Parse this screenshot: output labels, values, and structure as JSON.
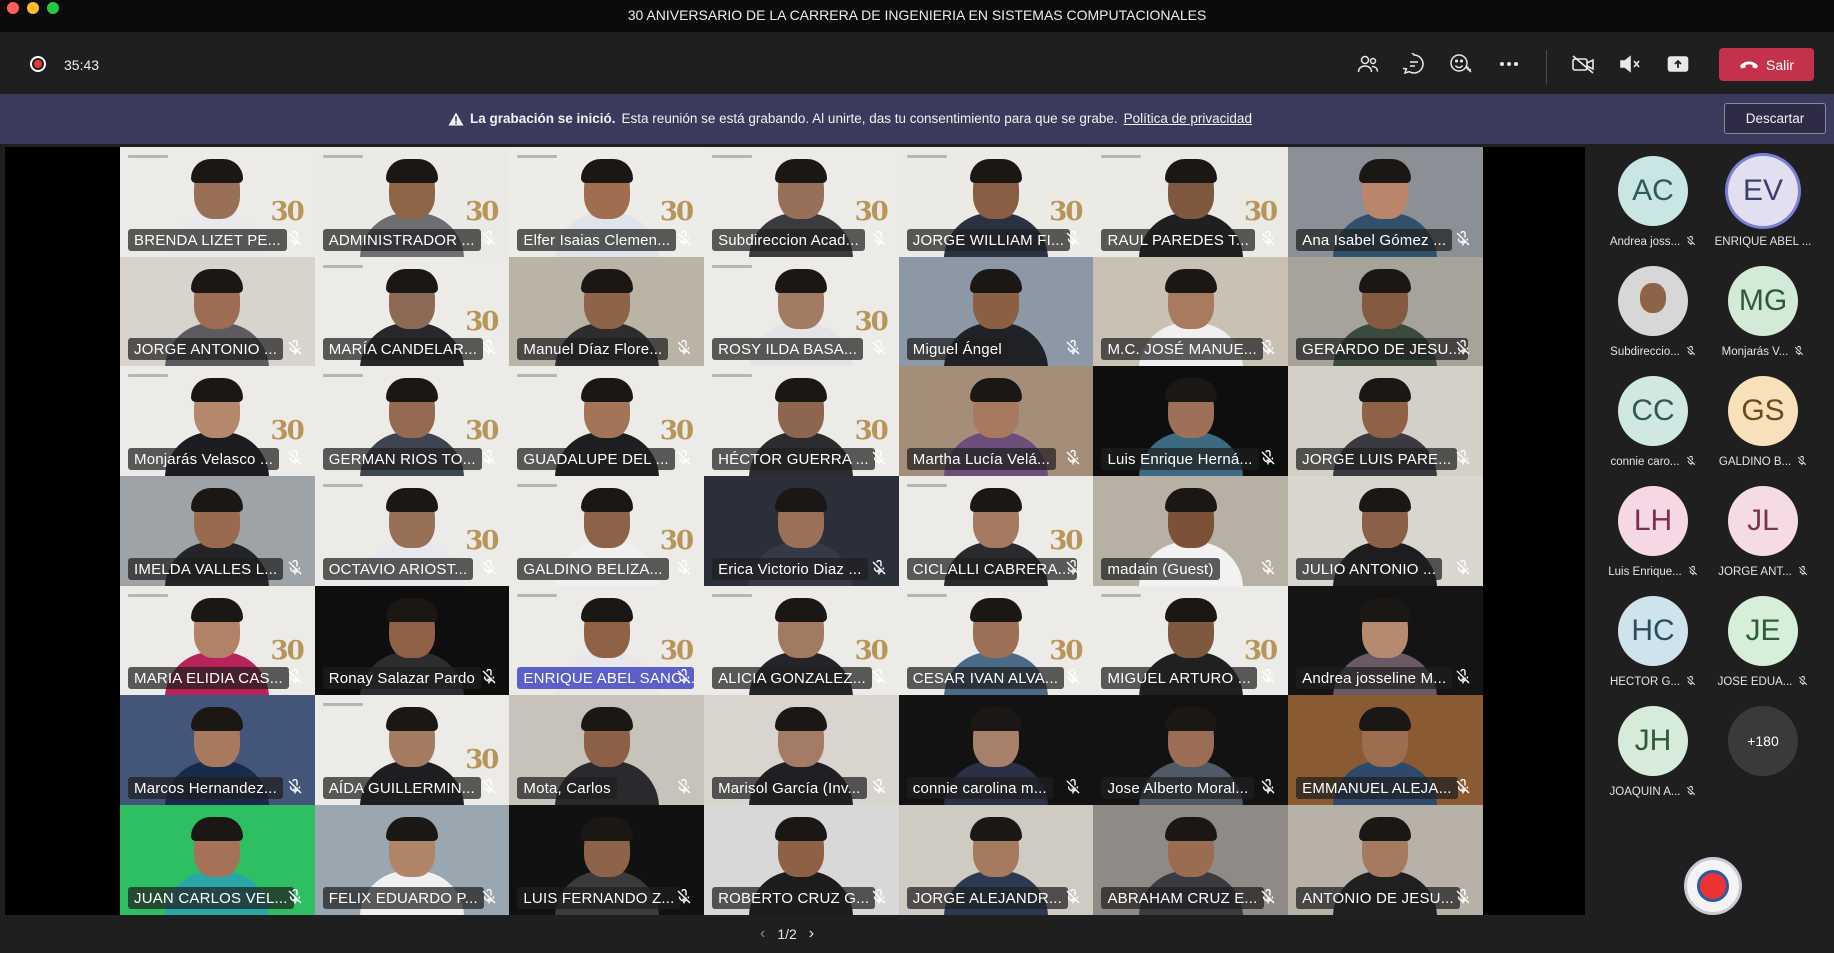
{
  "window": {
    "title": "30 ANIVERSARIO DE LA CARRERA DE INGENIERIA EN SISTEMAS COMPUTACIONALES"
  },
  "toolbar": {
    "timer": "35:43",
    "leave_label": "Salir",
    "icons": [
      "participants-icon",
      "chat-icon",
      "reactions-icon",
      "more-icon",
      "camera-off-icon",
      "mic-muted-icon",
      "share-icon"
    ]
  },
  "banner": {
    "title": "La grabación se inició.",
    "message": "Esta reunión se está grabando. Al unirte, das tu consentimiento para que se grabe.",
    "link": "Política de privacidad",
    "dismiss_label": "Descartar"
  },
  "tiles": [
    {
      "name": "BRENDA LIZET PE...",
      "bg": "#ecebe7",
      "skin": "#9a6f58",
      "shirt": "#e9e9ee",
      "logo": true
    },
    {
      "name": "ADMINISTRADOR ...",
      "bg": "#ebeae6",
      "skin": "#8f6447",
      "shirt": "#6d6f72",
      "logo": true
    },
    {
      "name": "Elfer Isaias Clemen...",
      "bg": "#edece8",
      "skin": "#a06d4f",
      "shirt": "#dfe3ea",
      "logo": true
    },
    {
      "name": "Subdireccion Acad...",
      "bg": "#ecebe7",
      "skin": "#98705a",
      "shirt": "#3b3b3f",
      "logo": true
    },
    {
      "name": "JORGE WILLIAM FI...",
      "bg": "#eceae5",
      "skin": "#8a5e44",
      "shirt": "#2b3042",
      "logo": true
    },
    {
      "name": "RAUL PAREDES  T...",
      "bg": "#ebe9e4",
      "skin": "#7e583f",
      "shirt": "#1f1f22",
      "logo": true
    },
    {
      "name": "Ana Isabel Gómez ...",
      "bg": "#8b8f96",
      "skin": "#b9866b",
      "shirt": "#33506b",
      "logo": false
    },
    {
      "name": "JORGE ANTONIO ...",
      "bg": "#d8d3cc",
      "skin": "#9c6d52",
      "shirt": "#5b5b60",
      "logo": false
    },
    {
      "name": "MARÍA CANDELAR...",
      "bg": "#ecebe7",
      "skin": "#8d6a55",
      "shirt": "#27272c",
      "logo": true
    },
    {
      "name": "Manuel Díaz Flore...",
      "bg": "#b9b4a6",
      "skin": "#8e6448",
      "shirt": "#2d2d30",
      "logo": false
    },
    {
      "name": "ROSY  ILDA BASA...",
      "bg": "#ecebe7",
      "skin": "#a37a62",
      "shirt": "#e4e4e8",
      "logo": true
    },
    {
      "name": "Miguel Ángel",
      "bg": "#8c98a6",
      "skin": "#8b5f44",
      "shirt": "#202226",
      "logo": false
    },
    {
      "name": "M.C. JOSÉ MANUE...",
      "bg": "#c9c1b4",
      "skin": "#a87a5e",
      "shirt": "#f0f0f0",
      "logo": false
    },
    {
      "name": "GERARDO DE JESU...",
      "bg": "#a6a39a",
      "skin": "#845a41",
      "shirt": "#3a4a3e",
      "logo": false
    },
    {
      "name": "Monjarás Velasco ...",
      "bg": "#ecebe7",
      "skin": "#b5876b",
      "shirt": "#1c1c20",
      "logo": true
    },
    {
      "name": "GERMAN RIOS  TO...",
      "bg": "#ecebe7",
      "skin": "#946a51",
      "shirt": "#3e4450",
      "logo": true
    },
    {
      "name": "GUADALUPE DEL ...",
      "bg": "#ecebe7",
      "skin": "#a47459",
      "shirt": "#1d1d22",
      "logo": true
    },
    {
      "name": "HÉCTOR GUERRA ...",
      "bg": "#ecebe7",
      "skin": "#8e664f",
      "shirt": "#2c2c30",
      "logo": true
    },
    {
      "name": "Martha Lucía Velá...",
      "bg": "#a48e7a",
      "skin": "#a77a60",
      "shirt": "#6b4e7a",
      "logo": false
    },
    {
      "name": "Luis Enrique Herná...",
      "bg": "#0e0e0e",
      "skin": "#9e7057",
      "shirt": "#3c6a80",
      "logo": false
    },
    {
      "name": "JORGE LUIS PARE...",
      "bg": "#d4cfc7",
      "skin": "#8f6247",
      "shirt": "#3a3a40",
      "logo": false
    },
    {
      "name": "IMELDA VALLES  L...",
      "bg": "#9ea3a8",
      "skin": "#9a6a4f",
      "shirt": "#242428",
      "logo": false
    },
    {
      "name": "OCTAVIO ARIOST...",
      "bg": "#ecebe7",
      "skin": "#987058",
      "shirt": "#e7e9ee",
      "logo": true
    },
    {
      "name": "GALDINO  BELIZA...",
      "bg": "#ecebe7",
      "skin": "#8c6248",
      "shirt": "#f0f0f0",
      "logo": true
    },
    {
      "name": "Erica Victorio Diaz ...",
      "bg": "#2a2f3a",
      "skin": "#9a7058",
      "shirt": "#353a46",
      "logo": false
    },
    {
      "name": "CICLALLI CABRERA...",
      "bg": "#ecebe7",
      "skin": "#a57a60",
      "shirt": "#2a2a2e",
      "logo": true
    },
    {
      "name": "madain (Guest)",
      "bg": "#b7b0a4",
      "skin": "#7c5138",
      "shirt": "#f2f2f2",
      "logo": false
    },
    {
      "name": "JULIO ANTONIO ...",
      "bg": "#d9d6cf",
      "skin": "#8b6047",
      "shirt": "#1d1d20",
      "logo": false
    },
    {
      "name": "MARIA ELIDIA CAS...",
      "bg": "#ecebe7",
      "skin": "#b28267",
      "shirt": "#b7235a",
      "logo": true
    },
    {
      "name": "Ronay Salazar Pardo",
      "bg": "#0e0e0e",
      "skin": "#8f6147",
      "shirt": "#2d2d30",
      "logo": false
    },
    {
      "name": "ENRIQUE ABEL SANC...",
      "bg": "#ecebe7",
      "skin": "#8f6246",
      "shirt": "#e8e8ec",
      "logo": true,
      "highlight": true
    },
    {
      "name": "ALICIA GONZALEZ...",
      "bg": "#ecebe7",
      "skin": "#a27a62",
      "shirt": "#24242a",
      "logo": true
    },
    {
      "name": "CESAR IVAN ALVA...",
      "bg": "#ecebe7",
      "skin": "#9c7056",
      "shirt": "#4a6a86",
      "logo": true
    },
    {
      "name": "MIGUEL ARTURO ...",
      "bg": "#ecebe7",
      "skin": "#7f5840",
      "shirt": "#202022",
      "logo": true
    },
    {
      "name": "Andrea josseline M...",
      "bg": "#141414",
      "skin": "#b58a6f",
      "shirt": "#6a5a66",
      "logo": false
    },
    {
      "name": "Marcos Hernandez...",
      "bg": "#44557a",
      "skin": "#a77a60",
      "shirt": "#1a2a4a",
      "logo": false
    },
    {
      "name": "AÍDA GUILLERMIN...",
      "bg": "#ecebe7",
      "skin": "#a47a60",
      "shirt": "#1e1e22",
      "logo": true
    },
    {
      "name": "Mota, Carlos",
      "bg": "#c7c3bb",
      "skin": "#8c6047",
      "shirt": "#2a2a2e",
      "logo": false
    },
    {
      "name": "Marisol García (Inv...",
      "bg": "#d9d4cd",
      "skin": "#a47c65",
      "shirt": "#202024",
      "logo": false
    },
    {
      "name": "connie carolina m...",
      "bg": "#121212",
      "skin": "#a8806a",
      "shirt": "#2b3046",
      "logo": false
    },
    {
      "name": "Jose Alberto Moral...",
      "bg": "#121212",
      "skin": "#9a6d54",
      "shirt": "#4f5a66",
      "logo": false
    },
    {
      "name": "EMMANUEL ALEJA...",
      "bg": "#8a5a32",
      "skin": "#9d6d4f",
      "shirt": "#2d4a6a",
      "logo": false
    },
    {
      "name": "JUAN CARLOS VEL...",
      "bg": "#2fbf63",
      "skin": "#a57258",
      "shirt": "#2aa8a8",
      "logo": false
    },
    {
      "name": "FELIX EDUARDO P...",
      "bg": "#9aa7b0",
      "skin": "#b08466",
      "shirt": "#f0f0f0",
      "logo": false
    },
    {
      "name": "LUIS FERNANDO Z...",
      "bg": "#111111",
      "skin": "#8d6449",
      "shirt": "#3a3a3a",
      "logo": false
    },
    {
      "name": "ROBERTO CRUZ  G...",
      "bg": "#d8d8d8",
      "skin": "#8e6045",
      "shirt": "#1c1c1c",
      "logo": false
    },
    {
      "name": "JORGE ALEJANDR...",
      "bg": "#cfcac2",
      "skin": "#a57a5f",
      "shirt": "#2b3a52",
      "logo": false
    },
    {
      "name": "ABRAHAM CRUZ E...",
      "bg": "#8f8a86",
      "skin": "#9a6d52",
      "shirt": "#3a3a40",
      "logo": false
    },
    {
      "name": "ANTONIO DE JESU...",
      "bg": "#b7b1a8",
      "skin": "#a57a5e",
      "shirt": "#202022",
      "logo": false
    }
  ],
  "pager": {
    "label": "1/2"
  },
  "side_panel": {
    "participants": [
      {
        "initials": "AC",
        "label": "Andrea joss...",
        "color": "#c9e6e4",
        "text": "#2e5a58",
        "muted": true
      },
      {
        "initials": "EV",
        "label": "ENRIQUE ABEL ...",
        "color": "#e1dff0",
        "text": "#3b3f6e",
        "muted": false,
        "ring": true
      },
      {
        "initials": "",
        "label": "Subdireccio...",
        "color": "#d7d7d7",
        "text": "#333333",
        "muted": true,
        "photo": true
      },
      {
        "initials": "MG",
        "label": "Monjarás V...",
        "color": "#d3ead7",
        "text": "#2e5a3a",
        "muted": true
      },
      {
        "initials": "CC",
        "label": "connie caro...",
        "color": "#d1e8e2",
        "text": "#2e5a50",
        "muted": true
      },
      {
        "initials": "GS",
        "label": "GALDINO B...",
        "color": "#f8e1ba",
        "text": "#6a4a1a",
        "muted": true
      },
      {
        "initials": "LH",
        "label": "Luis Enrique...",
        "color": "#f6d8e4",
        "text": "#7a2f50",
        "muted": true
      },
      {
        "initials": "JL",
        "label": "JORGE ANT...",
        "color": "#f5dce4",
        "text": "#7a3450",
        "muted": true
      },
      {
        "initials": "HC",
        "label": "HÉCTOR G...",
        "color": "#cfe3ec",
        "text": "#2a4e60",
        "muted": true
      },
      {
        "initials": "JE",
        "label": "JOSE EDUA...",
        "color": "#d7efd9",
        "text": "#2e5e36",
        "muted": true
      },
      {
        "initials": "JH",
        "label": "JOAQUIN A...",
        "color": "#d6ebd9",
        "text": "#2e5a3a",
        "muted": true
      }
    ],
    "overflow_label": "+180"
  }
}
